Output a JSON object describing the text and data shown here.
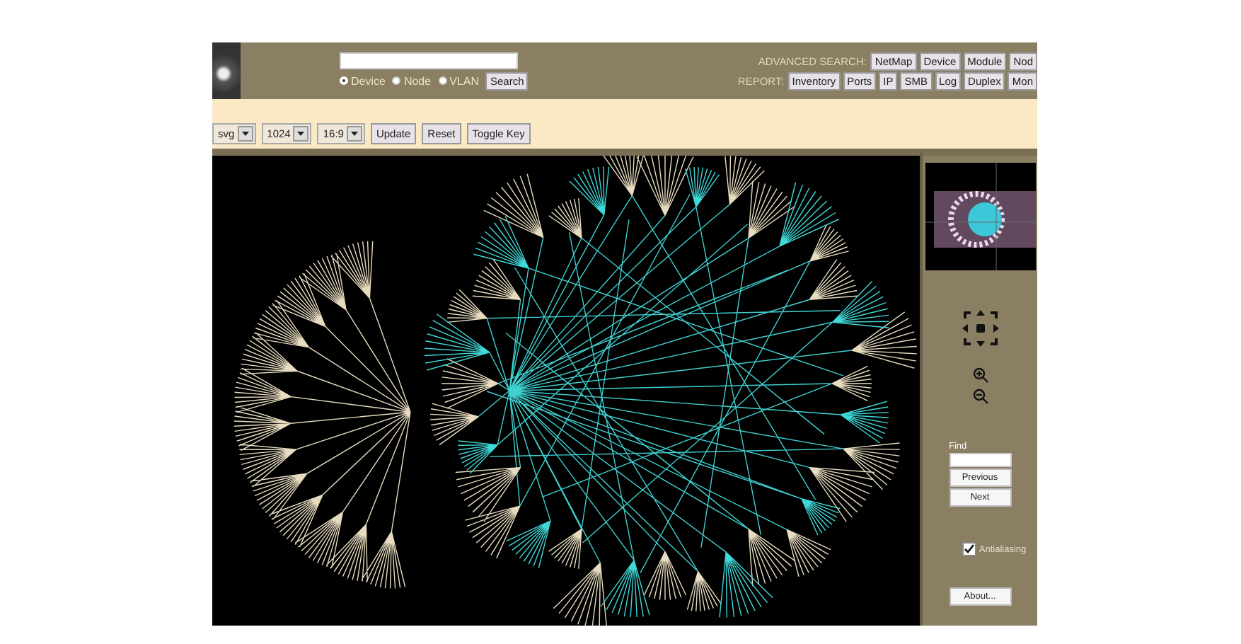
{
  "header": {
    "search_options": [
      {
        "label": "Device",
        "selected": true
      },
      {
        "label": "Node",
        "selected": false
      },
      {
        "label": "VLAN",
        "selected": false
      }
    ],
    "search_button": "Search",
    "advanced_search": {
      "label": "ADVANCED SEARCH:",
      "buttons": [
        "NetMap",
        "Device",
        "Module",
        "Nod"
      ]
    },
    "report": {
      "label": "REPORT:",
      "buttons": [
        "Inventory",
        "Ports",
        "IP",
        "SMB",
        "Log",
        "Duplex",
        "Mon"
      ]
    }
  },
  "toolbar": {
    "selects": [
      {
        "value": "svg"
      },
      {
        "value": "1024"
      },
      {
        "value": "16:9"
      }
    ],
    "buttons": [
      "Update",
      "Reset",
      "Toggle Key"
    ]
  },
  "side_panel": {
    "find_label": "Find",
    "find_buttons": [
      "Previous",
      "Next"
    ],
    "antialiasing": {
      "label": "Antialiasing",
      "checked": true
    },
    "about_button": "About..."
  }
}
